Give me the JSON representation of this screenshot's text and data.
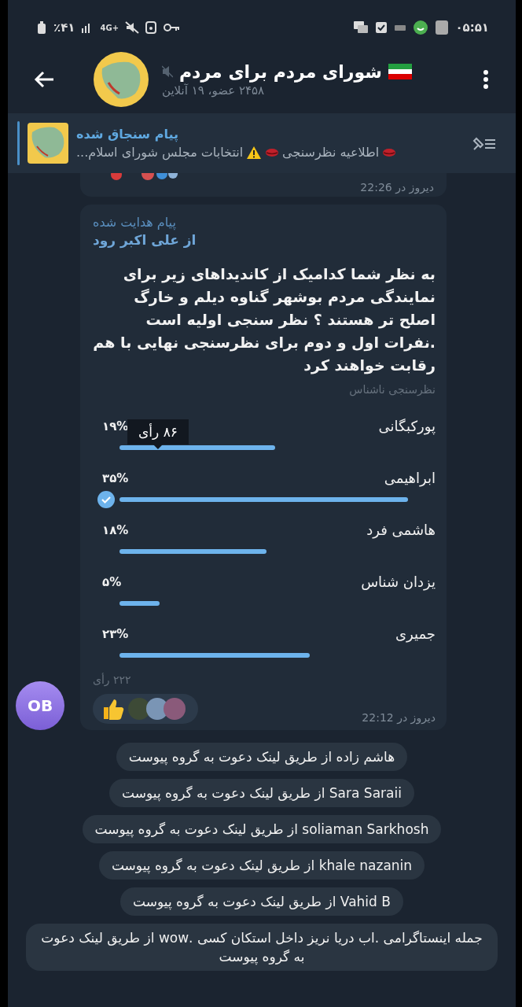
{
  "status_bar": {
    "battery": "٪۴۱",
    "network": "4G+",
    "time": "۰۵:۵۱"
  },
  "header": {
    "title": "شورای مردم برای مردم",
    "muted": true,
    "subtitle": "۲۴۵۸ عضو، ۱۹ آنلاین"
  },
  "pinned": {
    "label": "پیام سنجاق شده",
    "preview": [
      "اطلاعیه نظرسنجی",
      "انتخابات مجلس شورای اسلام..."
    ]
  },
  "previous_message": {
    "time": "دیروز در 22:26"
  },
  "poll": {
    "forwarded_label": "پیام هدایت شده",
    "forwarded_from": "از علی اکبر رود",
    "question": "به نظر شما کدامیک از کاندیداهای زیر برای نمایندگی مردم بوشهر گناوه دیلم و خارگ اصلح تر هستند ؟ نظر سنجی اولیه است .نفرات اول و دوم برای نظرسنجی نهایی با هم رقابت خواهند کرد",
    "type": "نظرسنجی ناشناس",
    "tooltip": "۸۶ رأی",
    "options": [
      {
        "label": "پورکبگانی",
        "percent": "۱۹%",
        "selected": false
      },
      {
        "label": "ابراهیمی",
        "percent": "۳۵%",
        "selected": true
      },
      {
        "label": "هاشمی فرد",
        "percent": "۱۸%",
        "selected": false
      },
      {
        "label": "یزدان شناس",
        "percent": "۵%",
        "selected": false
      },
      {
        "label": "جمیری",
        "percent": "۲۳%",
        "selected": false
      }
    ],
    "total_votes": "۲۲۲ رأی",
    "time": "دیروز در 22:12",
    "sender_initials": "OB"
  },
  "service_messages": [
    "هاشم زاده از طریق لینک دعوت به گروه پیوست",
    "Sara Saraii از طریق لینک دعوت به گروه پیوست",
    "soliaman Sarkhosh از طریق لینک دعوت به گروه پیوست",
    "khale nazanin از طریق لینک دعوت به گروه پیوست",
    "Vahid B از طریق لینک دعوت به گروه پیوست",
    "جمله اینستاگرامی .اب دریا نریز داخل استکان کسی .wow از طریق لینک دعوت به گروه پیوست"
  ]
}
